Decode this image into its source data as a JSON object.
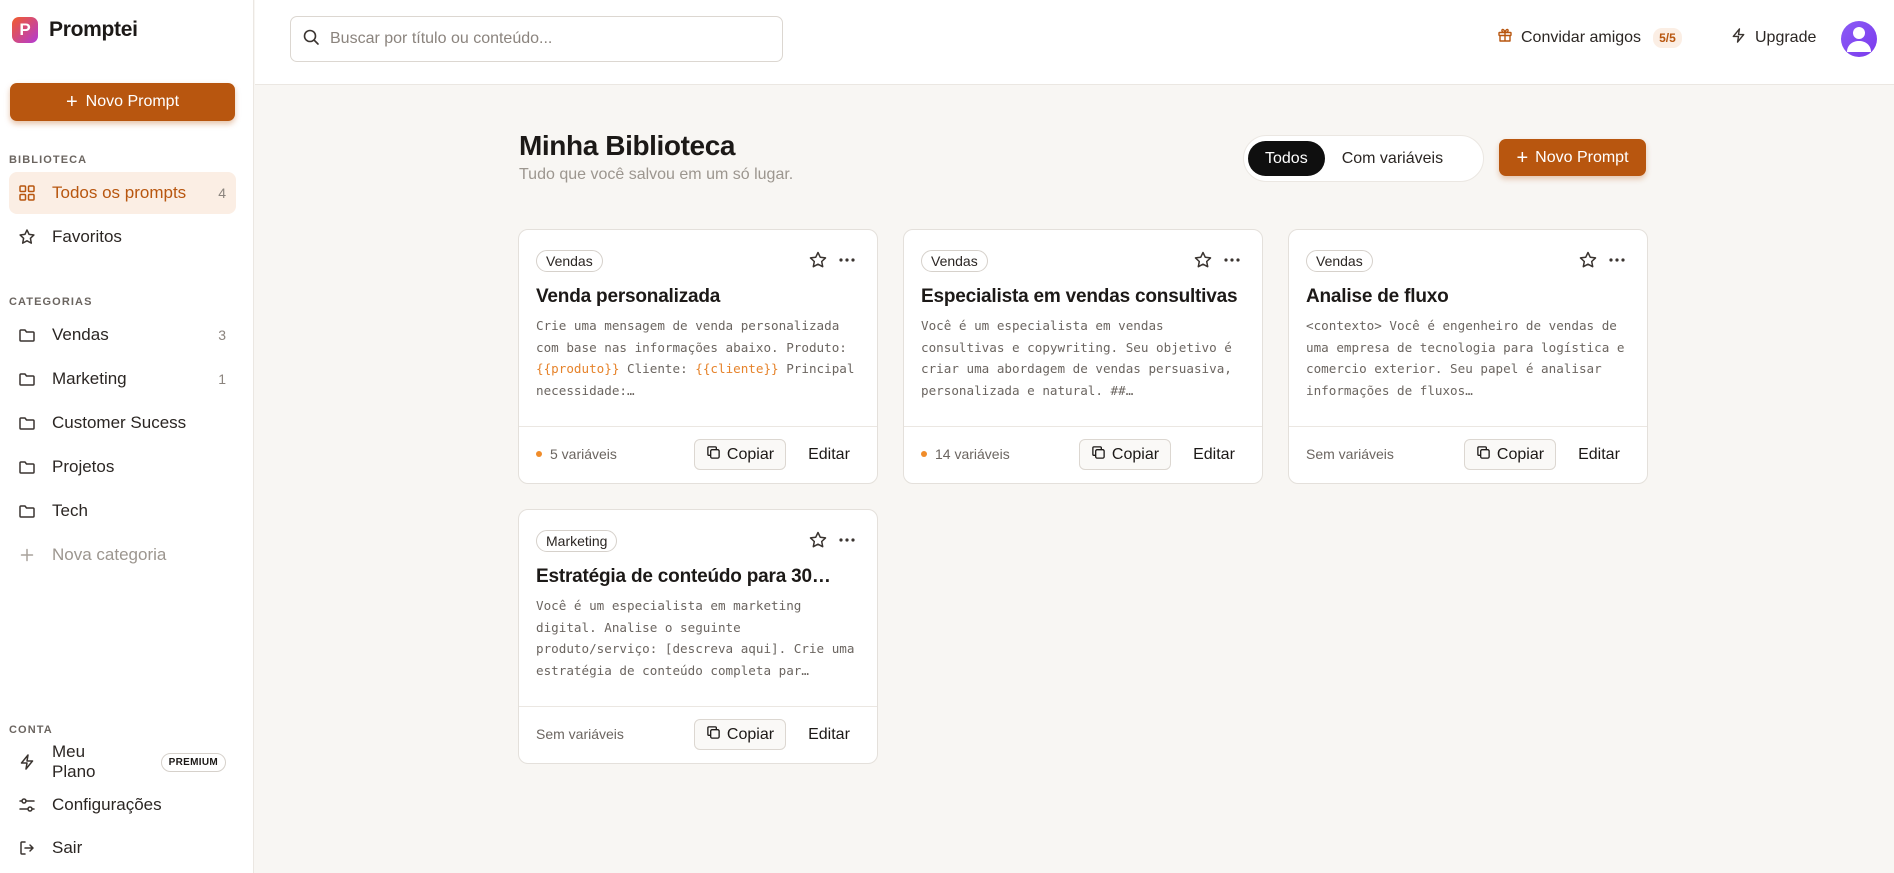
{
  "brand": {
    "name": "Promptei",
    "logo_letter": "P"
  },
  "sidebar": {
    "new_prompt_label": "Novo Prompt",
    "library_title": "BIBLIOTECA",
    "library_items": [
      {
        "label": "Todos os prompts",
        "count": "4",
        "icon": "grid-icon"
      },
      {
        "label": "Favoritos",
        "count": "",
        "icon": "star-icon"
      }
    ],
    "categories_title": "CATEGORIAS",
    "categories": [
      {
        "label": "Vendas",
        "count": "3"
      },
      {
        "label": "Marketing",
        "count": "1"
      },
      {
        "label": "Customer Sucess",
        "count": ""
      },
      {
        "label": "Projetos",
        "count": ""
      },
      {
        "label": "Tech",
        "count": ""
      }
    ],
    "new_category_label": "Nova categoria",
    "account_title": "CONTA",
    "account_items": [
      {
        "label": "Meu Plano",
        "badge": "PREMIUM",
        "icon": "lightning-icon"
      },
      {
        "label": "Configurações",
        "icon": "sliders-icon"
      },
      {
        "label": "Sair",
        "icon": "logout-icon"
      }
    ]
  },
  "topbar": {
    "search_placeholder": "Buscar por título ou conteúdo...",
    "invite_label": "Convidar amigos",
    "invite_count": "5/5",
    "upgrade_label": "Upgrade"
  },
  "main": {
    "title": "Minha Biblioteca",
    "subtitle": "Tudo que você salvou em um só lugar.",
    "filters": [
      "Todos",
      "Com variáveis"
    ],
    "active_filter": "Todos",
    "new_prompt_label": "Novo Prompt",
    "cards": [
      {
        "tag": "Vendas",
        "title": "Venda personalizada",
        "body_segments": [
          {
            "text": "Crie uma mensagem de venda personalizada com base nas informações abaixo. Produto: ",
            "var": false
          },
          {
            "text": "{{produto}}",
            "var": true
          },
          {
            "text": " Cliente: ",
            "var": false
          },
          {
            "text": "{{cliente}}",
            "var": true
          },
          {
            "text": " Principal necessidade:…",
            "var": false
          }
        ],
        "vars_label": "5 variáveis",
        "has_vars": true,
        "copy_label": "Copiar",
        "edit_label": "Editar"
      },
      {
        "tag": "Vendas",
        "title": "Especialista em vendas consultivas",
        "body_segments": [
          {
            "text": "Você é um especialista em vendas consultivas e copywriting. Seu objetivo é criar uma abordagem de vendas persuasiva, personalizada e natural. ##…",
            "var": false
          }
        ],
        "vars_label": "14 variáveis",
        "has_vars": true,
        "copy_label": "Copiar",
        "edit_label": "Editar"
      },
      {
        "tag": "Vendas",
        "title": "Analise de fluxo",
        "body_segments": [
          {
            "text": "<contexto> Você é engenheiro de vendas de uma empresa de tecnologia para logística e comercio exterior. Seu papel é analisar informações de fluxos…",
            "var": false
          }
        ],
        "vars_label": "Sem variáveis",
        "has_vars": false,
        "copy_label": "Copiar",
        "edit_label": "Editar"
      },
      {
        "tag": "Marketing",
        "title": "Estratégia de conteúdo para 30…",
        "body_segments": [
          {
            "text": "Você é um especialista em marketing digital. Analise o seguinte produto/serviço: [descreva aqui]. Crie uma estratégia de conteúdo completa par…",
            "var": false
          }
        ],
        "vars_label": "Sem variáveis",
        "has_vars": false,
        "copy_label": "Copiar",
        "edit_label": "Editar"
      }
    ]
  },
  "colors": {
    "accent": "#b8560f",
    "variable": "#e6832b",
    "dot": "#f08c2a",
    "avatar": "#7c3aed"
  }
}
